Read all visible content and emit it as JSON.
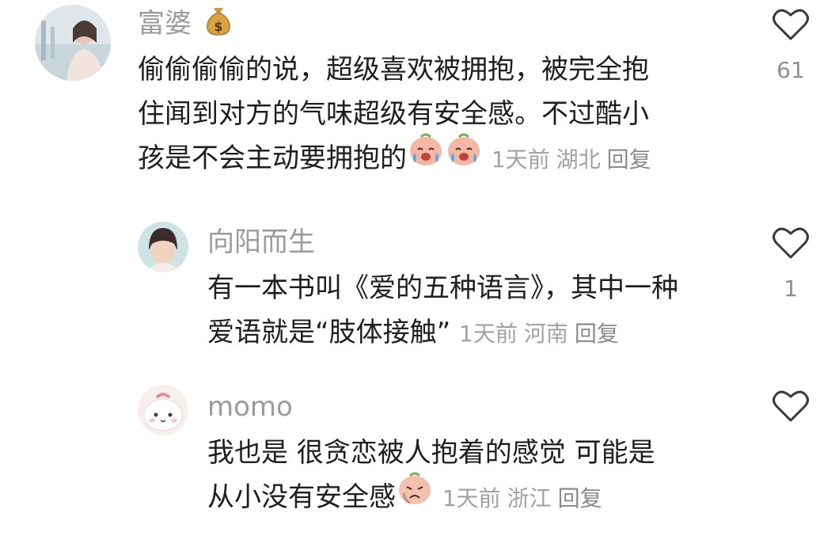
{
  "colors": {
    "muted_text": "#9b9b9b",
    "body_text": "#1e1e1e",
    "meta_text": "#a2a2a2"
  },
  "comments": [
    {
      "username": "富婆",
      "username_icon": "money-bag-icon",
      "lines": [
        "偷偷偷偷的说，超级喜欢被拥抱，被完全抱",
        "住闻到对方的气味超级有安全感。不过酷小",
        "孩是不会主动要拥抱的"
      ],
      "emojis": [
        "crying-face-emoji",
        "crying-face-emoji"
      ],
      "time": "1天前",
      "location": "湖北",
      "reply_label": "回复",
      "like_count": "61"
    },
    {
      "username": "向阳而生",
      "lines": [
        "有一本书叫《爱的五种语言》，其中一种",
        "爱语就是“肢体接触”"
      ],
      "time": "1天前",
      "location": "河南",
      "reply_label": "回复",
      "like_count": "1"
    },
    {
      "username": "momo",
      "lines": [
        "我也是 很贪恋被人抱着的感觉 可能是",
        "从小没有安全感"
      ],
      "emojis": [
        "sad-face-emoji"
      ],
      "time": "1天前",
      "location": "浙江",
      "reply_label": "回复",
      "like_count": ""
    }
  ]
}
